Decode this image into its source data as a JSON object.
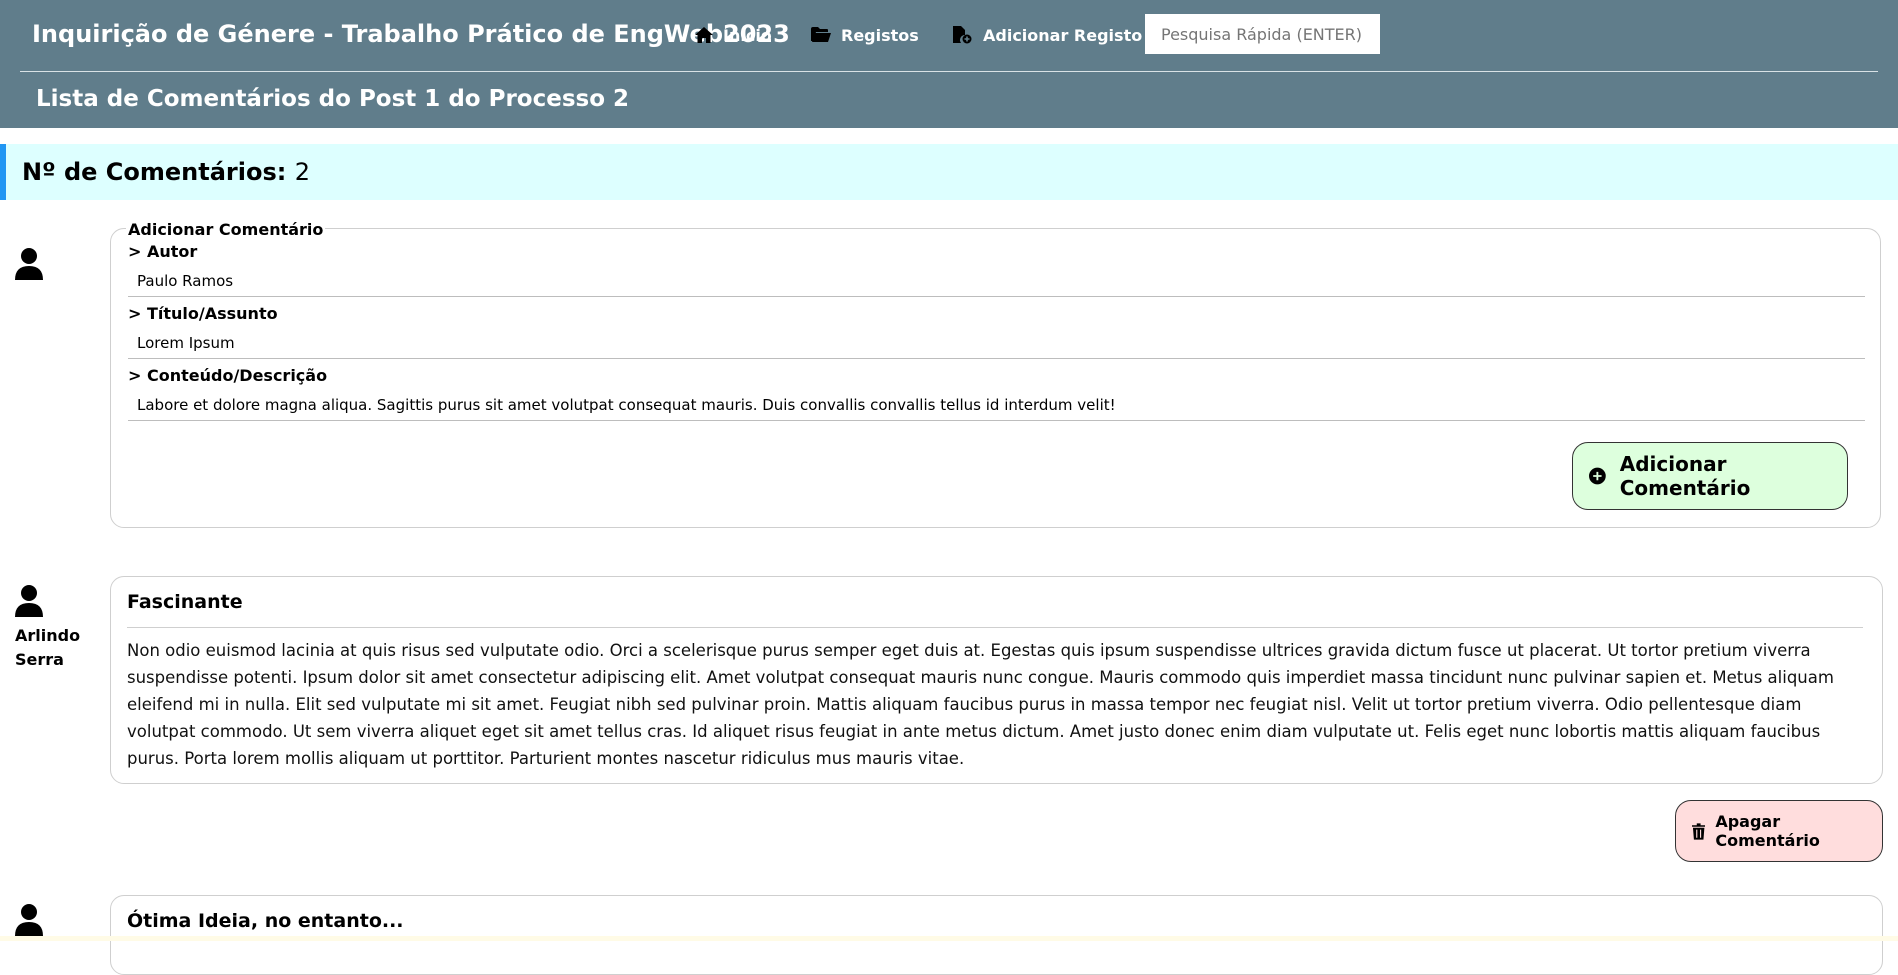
{
  "header": {
    "brand": "Inquirição de Génere - Trabalho Prático de EngWeb2023",
    "nav": [
      {
        "label": "Início",
        "icon": "home-icon"
      },
      {
        "label": "Registos",
        "icon": "folder-open-icon"
      },
      {
        "label": "Adicionar Registo",
        "icon": "file-add-icon"
      }
    ],
    "search_placeholder": "Pesquisa Rápida (ENTER)",
    "subtitle": "Lista de Comentários do Post 1 do Processo 2"
  },
  "count": {
    "label": "Nº de Comentários:",
    "value": "2"
  },
  "form": {
    "legend": "Adicionar Comentário",
    "author_label": "> Autor",
    "author_value": "Paulo Ramos",
    "title_label": "> Título/Assunto",
    "title_value": "Lorem Ipsum",
    "content_label": "> Conteúdo/Descrição",
    "content_value": "Labore et dolore magna aliqua. Sagittis purus sit amet volutpat consequat mauris. Duis convallis convallis tellus id interdum velit!",
    "submit_label": "Adicionar Comentário"
  },
  "comments": [
    {
      "author_first": "Arlindo",
      "author_last": "Serra",
      "title": "Fascinante",
      "body": "Non odio euismod lacinia at quis risus sed vulputate odio. Orci a scelerisque purus semper eget duis at. Egestas quis ipsum suspendisse ultrices gravida dictum fusce ut placerat. Ut tortor pretium viverra suspendisse potenti. Ipsum dolor sit amet consectetur adipiscing elit. Amet volutpat consequat mauris nunc congue. Mauris commodo quis imperdiet massa tincidunt nunc pulvinar sapien et. Metus aliquam eleifend mi in nulla. Elit sed vulputate mi sit amet. Feugiat nibh sed pulvinar proin. Mattis aliquam faucibus purus in massa tempor nec feugiat nisl. Velit ut tortor pretium viverra. Odio pellentesque diam volutpat commodo. Ut sem viverra aliquet eget sit amet tellus cras. Id aliquet risus feugiat in ante metus dictum. Amet justo donec enim diam vulputate ut. Felis eget nunc lobortis mattis aliquam faucibus purus. Porta lorem mollis aliquam ut porttitor. Parturient montes nascetur ridiculus mus mauris vitae.",
      "delete_label": "Apagar Comentário"
    },
    {
      "title": "Ótima Ideia, no entanto..."
    }
  ]
}
